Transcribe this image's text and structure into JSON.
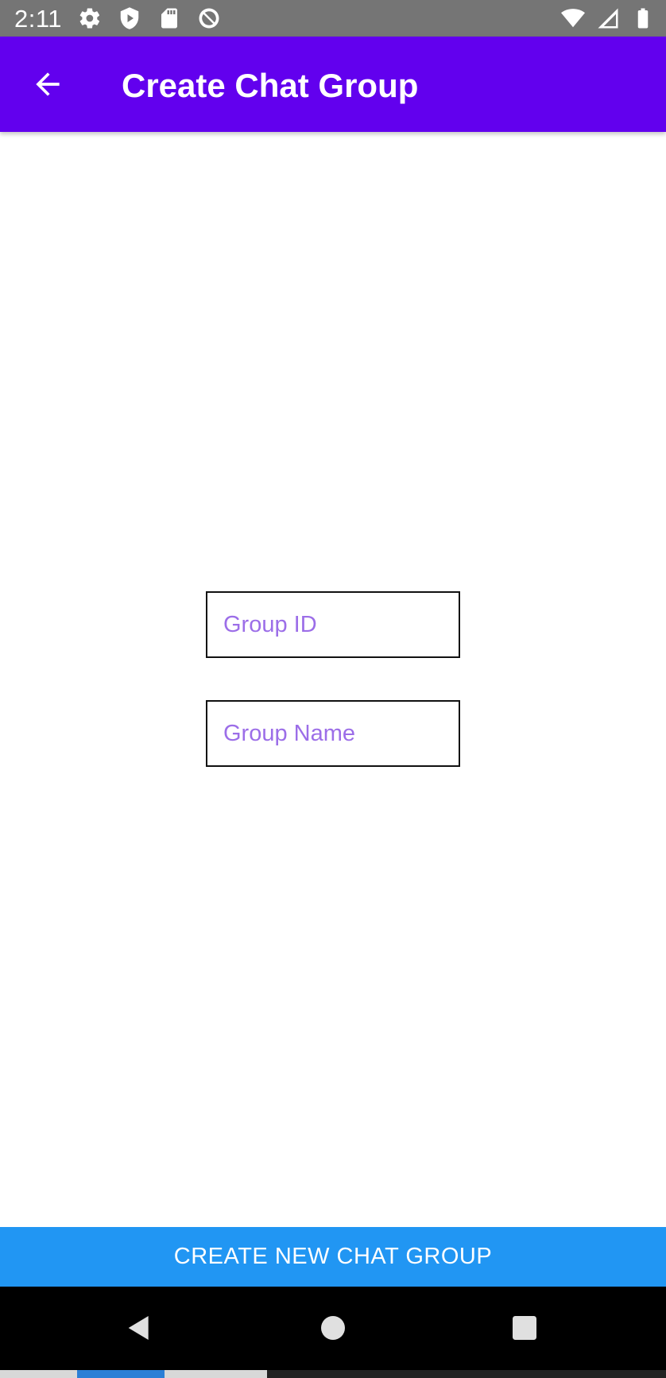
{
  "status_bar": {
    "time": "2:11",
    "left_icons": [
      "gear-icon",
      "shield-play-icon",
      "sd-card-icon",
      "no-sign-icon"
    ],
    "right_icons": [
      "wifi-icon",
      "cell-signal-icon",
      "battery-icon"
    ]
  },
  "app_bar": {
    "title": "Create Chat Group",
    "back_icon": "arrow-left-icon",
    "background": "#6200ee"
  },
  "form": {
    "group_id": {
      "placeholder": "Group ID",
      "value": ""
    },
    "group_name": {
      "placeholder": "Group Name",
      "value": ""
    }
  },
  "actions": {
    "create_label": "CREATE NEW CHAT GROUP",
    "button_color": "#2196f3"
  },
  "navigation": {
    "buttons": [
      "back-triangle-icon",
      "home-circle-icon",
      "recents-square-icon"
    ]
  }
}
